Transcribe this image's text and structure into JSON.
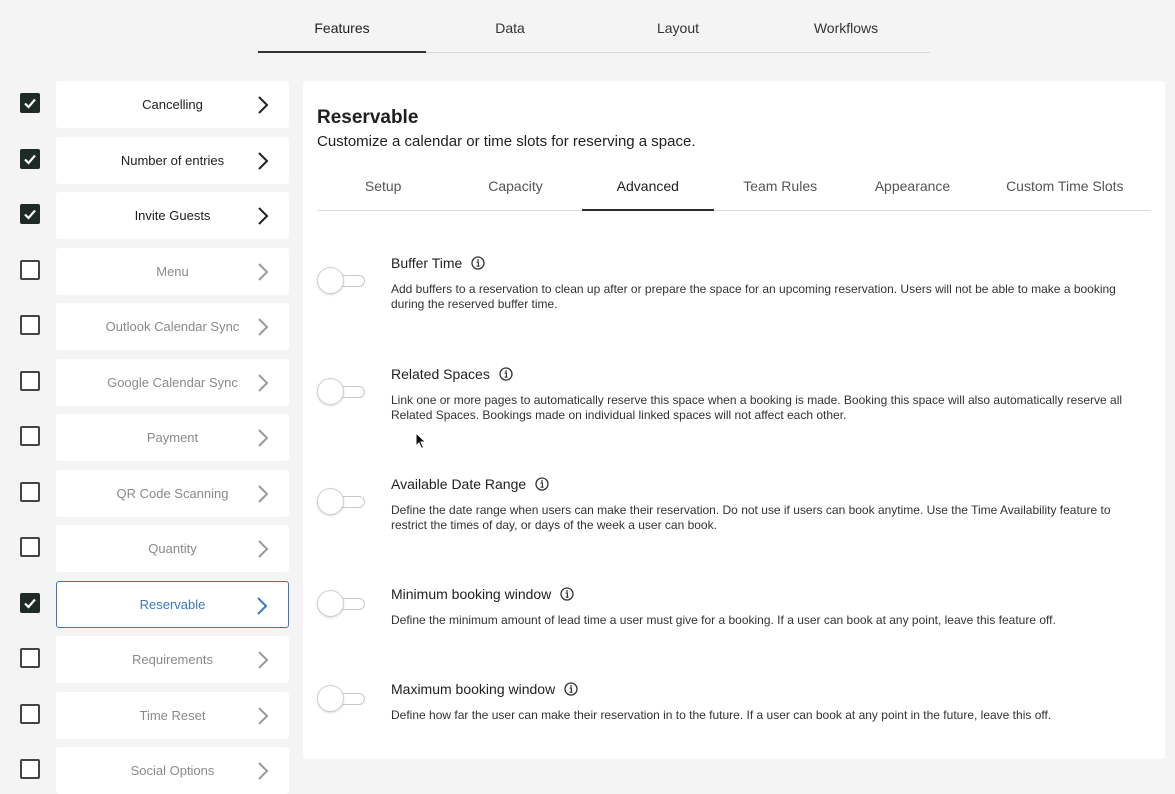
{
  "top_tabs": [
    {
      "label": "Features",
      "active": true
    },
    {
      "label": "Data",
      "active": false
    },
    {
      "label": "Layout",
      "active": false
    },
    {
      "label": "Workflows",
      "active": false
    }
  ],
  "features": [
    {
      "label": "Cancelling",
      "checked": true,
      "state": "enabled"
    },
    {
      "label": "Number of entries",
      "checked": true,
      "state": "enabled"
    },
    {
      "label": "Invite Guests",
      "checked": true,
      "state": "enabled"
    },
    {
      "label": "Menu",
      "checked": false,
      "state": "disabled"
    },
    {
      "label": "Outlook Calendar Sync",
      "checked": false,
      "state": "disabled"
    },
    {
      "label": "Google Calendar Sync",
      "checked": false,
      "state": "disabled"
    },
    {
      "label": "Payment",
      "checked": false,
      "state": "disabled"
    },
    {
      "label": "QR Code Scanning",
      "checked": false,
      "state": "disabled"
    },
    {
      "label": "Quantity",
      "checked": false,
      "state": "disabled"
    },
    {
      "label": "Reservable",
      "checked": true,
      "state": "selected"
    },
    {
      "label": "Requirements",
      "checked": false,
      "state": "disabled"
    },
    {
      "label": "Time Reset",
      "checked": false,
      "state": "disabled"
    },
    {
      "label": "Social Options",
      "checked": false,
      "state": "disabled"
    }
  ],
  "panel": {
    "title": "Reservable",
    "subtitle": "Customize a calendar or time slots for reserving a space.",
    "tabs": [
      {
        "label": "Setup",
        "active": false
      },
      {
        "label": "Capacity",
        "active": false
      },
      {
        "label": "Advanced",
        "active": true
      },
      {
        "label": "Team Rules",
        "active": false
      },
      {
        "label": "Appearance",
        "active": false
      },
      {
        "label": "Custom Time Slots",
        "active": false
      }
    ],
    "settings": [
      {
        "title": "Buffer Time",
        "enabled": false,
        "description": "Add buffers to a reservation to clean up after or prepare the space for an upcoming reservation. Users will not be able to make a booking during the reserved buffer time."
      },
      {
        "title": "Related Spaces",
        "enabled": false,
        "description": "Link one or more pages to automatically reserve this space when a booking is made. Booking this space will also automatically reserve all Related Spaces. Bookings made on individual linked spaces will not affect each other."
      },
      {
        "title": "Available Date Range",
        "enabled": false,
        "description": "Define the date range when users can make their reservation. Do not use if users can book anytime. Use the Time Availability feature to restrict the times of day, or days of the week a user can book."
      },
      {
        "title": "Minimum booking window",
        "enabled": false,
        "description": "Define the minimum amount of lead time a user must give for a booking. If a user can book at any point, leave this feature off."
      },
      {
        "title": "Maximum booking window",
        "enabled": false,
        "description": "Define how far the user can make their reservation in to the future. If a user can book at any point in the future, leave this off."
      }
    ]
  },
  "colors": {
    "accent": "#3b78c2",
    "checkbox_checked": "#1d2b24",
    "background": "#f4f4f4"
  }
}
